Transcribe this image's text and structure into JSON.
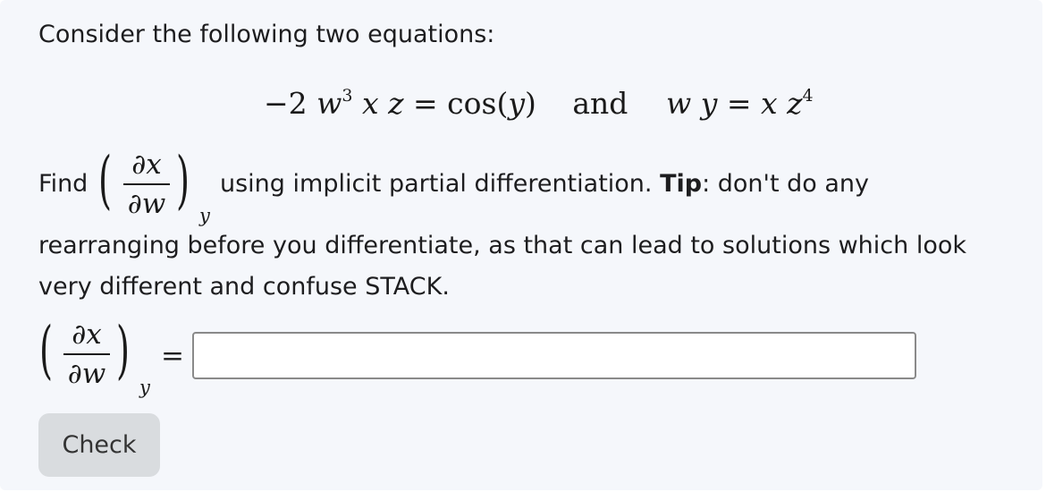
{
  "question": {
    "intro": "Consider the following two equations:",
    "eq1_lhs_coef": "−2",
    "eq1_w": "w",
    "eq1_w_exp": "3",
    "eq1_x": "x",
    "eq1_z": "z",
    "eq1_equals": "=",
    "eq1_rhs": "cos(",
    "eq1_rhs_var": "y",
    "eq1_rhs_close": ")",
    "and_word": "and",
    "eq2_w": "w",
    "eq2_y": "y",
    "eq2_equals": "=",
    "eq2_x": "x",
    "eq2_z": "z",
    "eq2_z_exp": "4",
    "find_word": "Find",
    "partial_num": "∂x",
    "partial_den": "∂w",
    "held_const": "y",
    "instruction_pre": "using implicit partial differentiation.",
    "tip_label": "Tip",
    "tip_text": ": don't do any",
    "line2": "rearranging before you differentiate, as that can lead to solutions which look",
    "line3": "very different and confuse STACK."
  },
  "answer": {
    "equals": "=",
    "value": ""
  },
  "check_button": {
    "label": "Check"
  }
}
